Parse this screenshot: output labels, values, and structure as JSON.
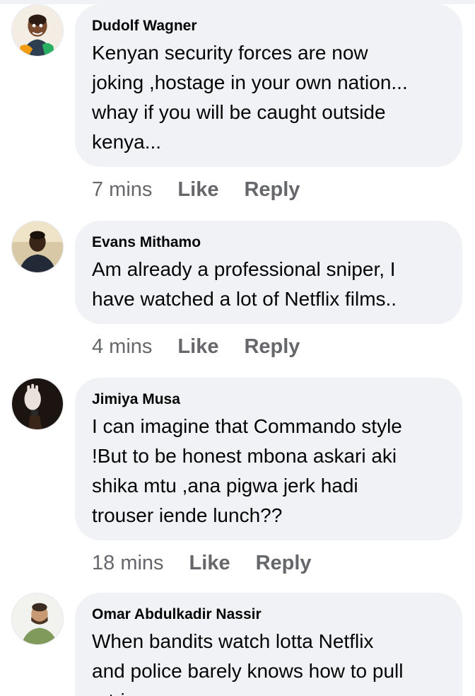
{
  "comments": [
    {
      "author": "Dudolf Wagner",
      "text": "Kenyan security forces are now\njoking ,hostage in your own nation...\nwhay if you will be caught outside\nkenya...",
      "time": "7 mins",
      "like": "Like",
      "reply": "Reply",
      "avatar_icon": "caricature-avatar"
    },
    {
      "author": "Evans Mithamo",
      "text": "Am already a professional sniper, I\nhave watched a lot of Netflix films..",
      "time": "4 mins",
      "like": "Like",
      "reply": "Reply",
      "avatar_icon": "person-photo-avatar"
    },
    {
      "author": "Jimiya Musa",
      "text": "I can imagine that Commando style\n!But to be honest mbona askari aki\nshika mtu ,ana pigwa jerk hadi\ntrouser iende lunch??",
      "time": "18 mins",
      "like": "Like",
      "reply": "Reply",
      "avatar_icon": "hand-photo-avatar"
    },
    {
      "author": "Omar Abdulkadir Nassir",
      "text": "When bandits watch lotta Netflix\nand police barely knows how to pull\nn trigger...",
      "time": "",
      "like": "",
      "reply": "",
      "avatar_icon": "person-photo-avatar"
    }
  ],
  "colors": {
    "bubble": "#f0f2f5",
    "text": "#050505",
    "secondary": "#65676b"
  }
}
